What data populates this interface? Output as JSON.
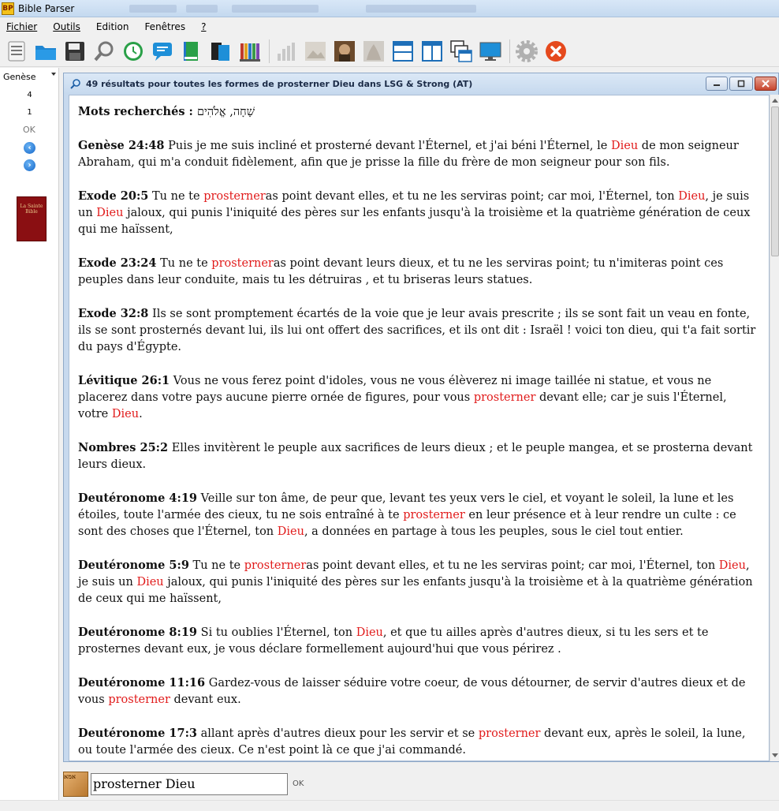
{
  "app": {
    "title": "Bible Parser",
    "icon_text": "BP"
  },
  "menu": [
    {
      "label": "Fichier"
    },
    {
      "label": "Outils"
    },
    {
      "label": "Edition"
    },
    {
      "label": "Fenêtres"
    },
    {
      "label": "?"
    }
  ],
  "toolbar": [
    "list-icon",
    "open-folder-icon",
    "save-icon",
    "search-icon",
    "history-icon",
    "chat-icon",
    "book-green-icon",
    "books-icon",
    "bookshelf-icon",
    "chart-icon",
    "image-icon",
    "portrait-icon",
    "photo-icon",
    "window-horizontal-icon",
    "window-vertical-icon",
    "cascade-icon",
    "monitor-icon",
    "settings-icon",
    "close-icon"
  ],
  "sidebar": {
    "book": "Genèse",
    "chapter": "4",
    "verse": "1",
    "ok": "OK",
    "cover_line1": "La Sainte",
    "cover_line2": "Bible"
  },
  "results_window": {
    "title": "49 résultats pour toutes les formes de prosterner Dieu dans LSG & Strong (AT)",
    "searched_label": "Mots recherchés : ",
    "searched_words": "שָׁחָה, אֱלֹהִים",
    "verses": [
      {
        "ref": "Genèse 24:48",
        "segments": [
          {
            "t": " Puis je me suis incliné et prosterné devant l'Éternel, et j'ai béni l'Éternel, le "
          },
          {
            "t": "Dieu",
            "hl": true
          },
          {
            "t": " de mon seigneur Abraham, qui m'a conduit fidèlement, afin que je prisse la fille du frère de mon seigneur pour son fils."
          }
        ]
      },
      {
        "ref": "Exode 20:5",
        "segments": [
          {
            "t": " Tu ne te "
          },
          {
            "t": "prosterner",
            "hl": true
          },
          {
            "t": "as point devant elles, et tu ne les serviras point; car moi, l'Éternel, ton "
          },
          {
            "t": "Dieu",
            "hl": true
          },
          {
            "t": ", je suis un "
          },
          {
            "t": "Dieu",
            "hl": true
          },
          {
            "t": " jaloux, qui punis l'iniquité des pères sur les enfants jusqu'à la troisième et la quatrième génération de ceux qui me haïssent,"
          }
        ]
      },
      {
        "ref": "Exode 23:24",
        "segments": [
          {
            "t": " Tu ne te "
          },
          {
            "t": "prosterner",
            "hl": true
          },
          {
            "t": "as point devant leurs dieux, et tu ne les serviras point; tu n'imiteras point ces peuples dans leur conduite, mais tu les détruiras , et tu briseras leurs statues."
          }
        ]
      },
      {
        "ref": "Exode 32:8",
        "segments": [
          {
            "t": " Ils se sont promptement écartés de la voie que je leur avais prescrite ; ils se sont fait un veau en fonte, ils se sont prosternés devant lui, ils lui ont offert des sacrifices, et ils ont dit : Israël ! voici ton dieu, qui t'a fait sortir du pays d'Égypte."
          }
        ]
      },
      {
        "ref": "Lévitique 26:1",
        "segments": [
          {
            "t": " Vous ne vous ferez point d'idoles, vous ne vous élèverez ni image taillée ni statue, et vous ne placerez dans votre pays aucune pierre ornée de figures, pour vous "
          },
          {
            "t": "prosterner",
            "hl": true
          },
          {
            "t": " devant elle; car je suis l'Éternel, votre "
          },
          {
            "t": "Dieu",
            "hl": true
          },
          {
            "t": "."
          }
        ]
      },
      {
        "ref": "Nombres 25:2",
        "segments": [
          {
            "t": " Elles invitèrent le peuple aux sacrifices de leurs dieux ; et le peuple mangea, et se prosterna devant leurs dieux."
          }
        ]
      },
      {
        "ref": "Deutéronome 4:19",
        "segments": [
          {
            "t": " Veille sur ton âme, de peur que, levant tes yeux vers le ciel, et voyant le soleil, la lune et les étoiles, toute l'armée des cieux, tu ne sois entraîné à te "
          },
          {
            "t": "prosterner",
            "hl": true
          },
          {
            "t": " en leur présence et à leur rendre un culte : ce sont des choses que l'Éternel, ton "
          },
          {
            "t": "Dieu",
            "hl": true
          },
          {
            "t": ", a données en partage à tous les peuples, sous le ciel tout entier."
          }
        ]
      },
      {
        "ref": "Deutéronome 5:9",
        "segments": [
          {
            "t": " Tu ne te "
          },
          {
            "t": "prosterner",
            "hl": true
          },
          {
            "t": "as point devant elles, et tu ne les serviras point; car moi, l'Éternel, ton "
          },
          {
            "t": "Dieu",
            "hl": true
          },
          {
            "t": ", je suis un "
          },
          {
            "t": "Dieu",
            "hl": true
          },
          {
            "t": " jaloux, qui punis l'iniquité des pères sur les enfants jusqu'à la troisième et à la quatrième génération de ceux qui me haïssent,"
          }
        ]
      },
      {
        "ref": "Deutéronome 8:19",
        "segments": [
          {
            "t": " Si tu oublies l'Éternel, ton "
          },
          {
            "t": "Dieu",
            "hl": true
          },
          {
            "t": ", et que tu ailles après d'autres dieux, si tu les sers et te prosternes devant eux, je vous déclare formellement aujourd'hui que vous périrez ."
          }
        ]
      },
      {
        "ref": "Deutéronome 11:16",
        "segments": [
          {
            "t": " Gardez-vous de laisser séduire votre coeur, de vous détourner, de servir d'autres dieux et de vous "
          },
          {
            "t": "prosterner",
            "hl": true
          },
          {
            "t": " devant eux."
          }
        ]
      },
      {
        "ref": "Deutéronome 17:3",
        "segments": [
          {
            "t": " allant après d'autres dieux pour les servir et se "
          },
          {
            "t": "prosterner",
            "hl": true
          },
          {
            "t": " devant eux, après le soleil, la lune, ou toute l'armée des cieux. Ce n'est point là ce que j'ai commandé."
          }
        ]
      }
    ]
  },
  "search": {
    "value": "prosterner Dieu",
    "ok": "OK",
    "avatar_text": "אמא"
  },
  "colors": {
    "highlight": "#e11b1b",
    "accent": "#c7d9ee"
  }
}
